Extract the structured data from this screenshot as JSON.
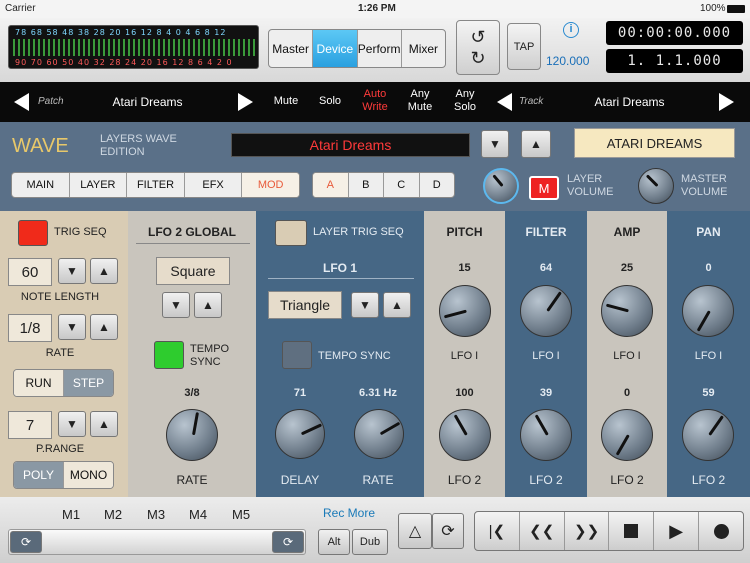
{
  "status": {
    "carrier": "Carrier",
    "time": "1:26 PM",
    "battery": "100%"
  },
  "meter": {
    "top": "78 68 58 48 38 28 20 16 12 8 4 0 4 6 8 12",
    "bottom": "90 70 60 50 40 32 28 24 20 16 12 8 6 4 2 0"
  },
  "tabs": [
    "Master",
    "Device",
    "Perform",
    "Mixer"
  ],
  "tabs_active": "Device",
  "tap_label": "TAP",
  "tempo": "120.000",
  "info_label": "i",
  "time_display": "00:00:00.000",
  "position_display": "1. 1.1.000",
  "nav": {
    "patch_label": "Patch",
    "patch_name": "Atari Dreams",
    "mute": "Mute",
    "solo": "Solo",
    "auto_write": "Auto Write",
    "any_mute": "Any Mute",
    "any_solo": "Any Solo",
    "track_label": "Track",
    "track_name": "Atari Dreams"
  },
  "header": {
    "title": "WAVE",
    "subtitle": "LAYERS WAVE EDITION",
    "patch_display": "Atari Dreams",
    "patch_tag": "ATARI DREAMS"
  },
  "page_tabs": [
    "MAIN",
    "LAYER",
    "FILTER",
    "EFX",
    "MOD"
  ],
  "page_tabs_active": "MOD",
  "layer_tabs": [
    "A",
    "B",
    "C",
    "D"
  ],
  "layer_tabs_active": "A",
  "layer_volume_label": "LAYER VOLUME",
  "master_volume_label": "MASTER VOLUME",
  "m_label": "M",
  "left": {
    "trig_seq": "TRIG SEQ",
    "note_length_value": "60",
    "note_length_label": "NOTE LENGTH",
    "rate_value": "1/8",
    "rate_label": "RATE",
    "run": "RUN",
    "step": "STEP",
    "prange_value": "7",
    "prange_label": "P.RANGE",
    "poly": "POLY",
    "mono": "MONO"
  },
  "lfo2": {
    "title": "LFO 2  GLOBAL",
    "wave": "Square",
    "tempo_sync": "TEMPO SYNC",
    "rate_value": "3/8",
    "rate_label": "RATE"
  },
  "lfo1": {
    "layer_trig_seq": "LAYER TRIG SEQ",
    "title": "LFO 1",
    "wave": "Triangle",
    "tempo_sync": "TEMPO SYNC",
    "delay_value": "71",
    "delay_label": "DELAY",
    "rate_value": "6.31 Hz",
    "rate_label": "RATE"
  },
  "mods": [
    {
      "title": "PITCH",
      "lfo1_value": "15",
      "lfo1_label": "LFO I",
      "lfo2_value": "100",
      "lfo2_label": "LFO 2"
    },
    {
      "title": "FILTER",
      "lfo1_value": "64",
      "lfo1_label": "LFO I",
      "lfo2_value": "39",
      "lfo2_label": "LFO 2"
    },
    {
      "title": "AMP",
      "lfo1_value": "25",
      "lfo1_label": "LFO I",
      "lfo2_value": "0",
      "lfo2_label": "LFO 2"
    },
    {
      "title": "PAN",
      "lfo1_value": "0",
      "lfo1_label": "LFO I",
      "lfo2_value": "59",
      "lfo2_label": "LFO 2"
    }
  ],
  "bottom": {
    "macros": [
      "M1",
      "M2",
      "M3",
      "M4",
      "M5"
    ],
    "rec_more": "Rec More",
    "alt": "Alt",
    "dub": "Dub"
  },
  "colors": {
    "accent": "#2aa0e0",
    "record_red": "#e22",
    "tempo_sync_green": "#2ecc2e",
    "mod_tab": "#e85a3a"
  }
}
